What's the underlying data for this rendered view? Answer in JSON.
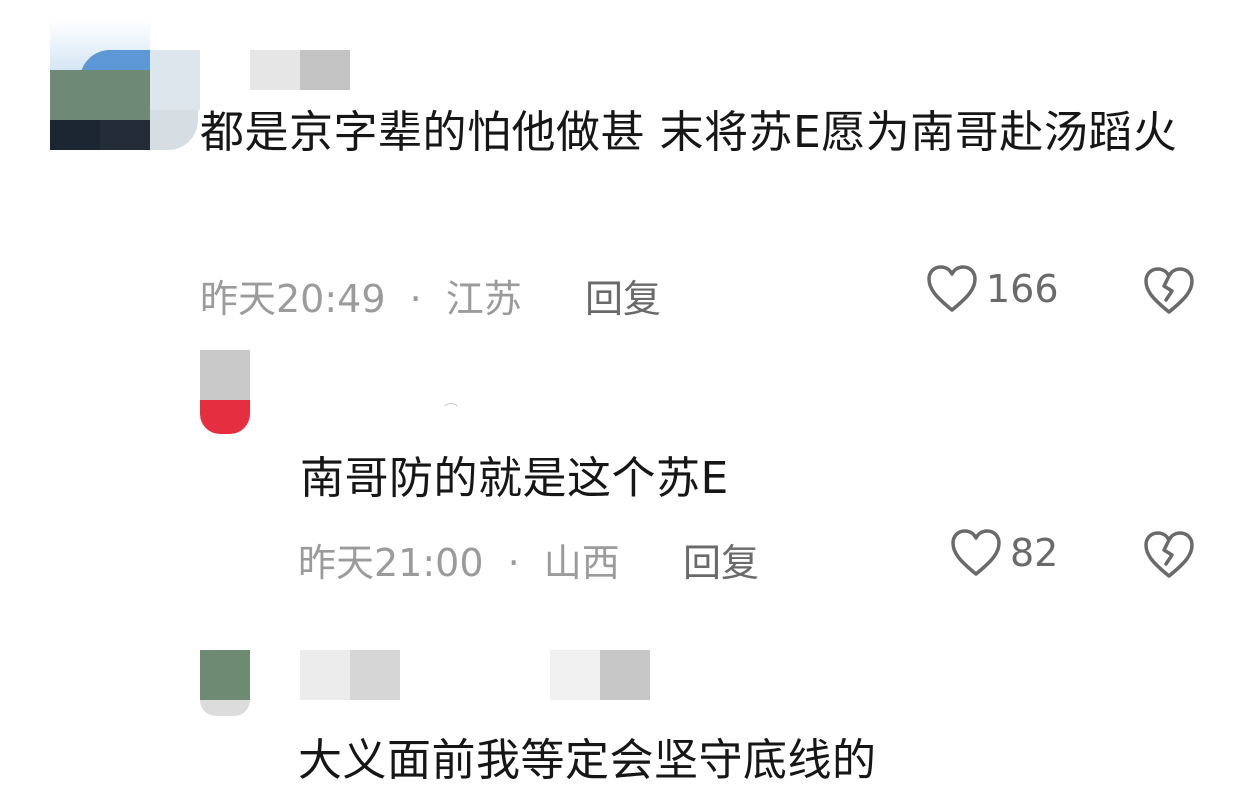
{
  "comments": [
    {
      "text": "都是京字辈的怕他做甚  末将苏E愿为南哥赴汤蹈火",
      "time": "昨天20:49",
      "separator": "·",
      "location": "江苏",
      "reply_label": "回复",
      "likes": "166",
      "like_icon": "heart-outline",
      "dislike_icon": "broken-heart-outline"
    }
  ],
  "replies": [
    {
      "text": "南哥防的就是这个苏E",
      "time": "昨天21:00",
      "separator": "·",
      "location": "山西",
      "reply_label": "回复",
      "likes": "82",
      "like_icon": "heart-outline",
      "dislike_icon": "broken-heart-outline"
    },
    {
      "text": "大义面前我等定会坚守底线的"
    }
  ],
  "colors": {
    "text": "#161616",
    "meta": "#9b9b9b",
    "action": "#6a6a6a"
  }
}
